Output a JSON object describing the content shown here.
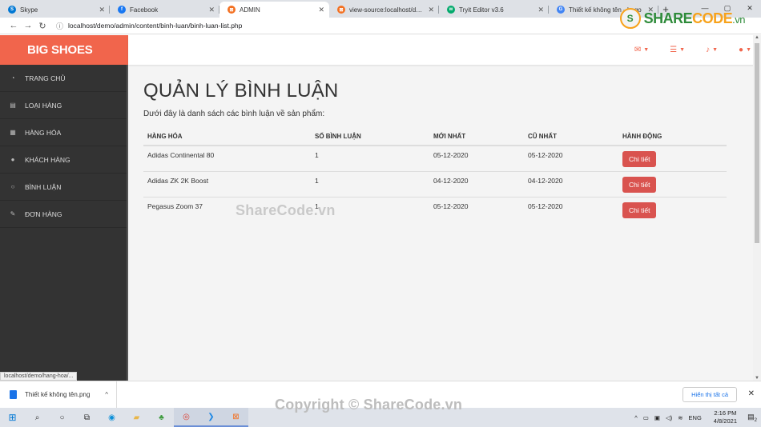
{
  "browser": {
    "tabs": [
      {
        "label": "Skype",
        "icon": "skype-icon",
        "color": "#0078d4",
        "glyph": "S"
      },
      {
        "label": "Facebook",
        "icon": "facebook-icon",
        "color": "#1877f2",
        "glyph": "f"
      },
      {
        "label": "ADMIN",
        "icon": "xampp-icon",
        "color": "#f37021",
        "glyph": "⊠"
      },
      {
        "label": "view-source:localhost/demo/",
        "icon": "xampp-icon",
        "color": "#f37021",
        "glyph": "⊠"
      },
      {
        "label": "Tryit Editor v3.6",
        "icon": "w3schools-icon",
        "color": "#04aa6d",
        "glyph": "w"
      },
      {
        "label": "Thiết kế không tên - Logo",
        "icon": "google-icon",
        "color": "#4285f4",
        "glyph": "G"
      }
    ],
    "url": "localhost/demo/admin/content/binh-luan/binh-luan-list.php",
    "watermark_logo": {
      "left": "SHARE",
      "right": "CODE",
      "suffix": ".vn"
    }
  },
  "app": {
    "brand": "BIG SHOES",
    "accent": "#f1654c",
    "sidebar": [
      {
        "label": "TRANG CHỦ",
        "icon": "dashboard-icon",
        "glyph": "◔"
      },
      {
        "label": "LOẠI HÀNG",
        "icon": "list-icon",
        "glyph": "▤"
      },
      {
        "label": "HÀNG HÓA",
        "icon": "products-icon",
        "glyph": "▦"
      },
      {
        "label": "KHÁCH HÀNG",
        "icon": "user-icon",
        "glyph": "●"
      },
      {
        "label": "BÌNH LUẬN",
        "icon": "comment-icon",
        "glyph": "○"
      },
      {
        "label": "ĐƠN HÀNG",
        "icon": "edit-icon",
        "glyph": "✎"
      }
    ],
    "topnav_icons": [
      {
        "icon": "envelope-icon",
        "glyph": "✉"
      },
      {
        "icon": "tasks-icon",
        "glyph": "☰"
      },
      {
        "icon": "bell-icon",
        "glyph": "♪"
      },
      {
        "icon": "user-icon",
        "glyph": "●"
      }
    ]
  },
  "content": {
    "title": "QUẢN LÝ BÌNH LUẬN",
    "intro": "Dưới đây là danh sách các bình luận về sản phẩm:",
    "columns": [
      "HÀNG HÓA",
      "SỐ BÌNH LUẬN",
      "MỚI NHẤT",
      "CŨ NHẤT",
      "HÀNH ĐỘNG"
    ],
    "rows": [
      {
        "product": "Adidas Continental 80",
        "count": "1",
        "newest": "05-12-2020",
        "oldest": "05-12-2020",
        "action": "Chi tiết"
      },
      {
        "product": "Adidas ZK 2K Boost",
        "count": "1",
        "newest": "04-12-2020",
        "oldest": "04-12-2020",
        "action": "Chi tiết"
      },
      {
        "product": "Pegasus Zoom 37",
        "count": "1",
        "newest": "05-12-2020",
        "oldest": "05-12-2020",
        "action": "Chi tiết"
      }
    ],
    "status_url": "localhost/demo/hang-hoa/..."
  },
  "downloads": {
    "file": "Thiết kế không tên.png",
    "show_all": "Hiển thị tất cả"
  },
  "taskbar": {
    "lang": "ENG",
    "time": "2:16 PM",
    "date": "4/8/2021",
    "notif_count": "2"
  },
  "watermarks": {
    "center": "ShareCode.vn",
    "bottom": "Copyright © ShareCode.vn"
  }
}
